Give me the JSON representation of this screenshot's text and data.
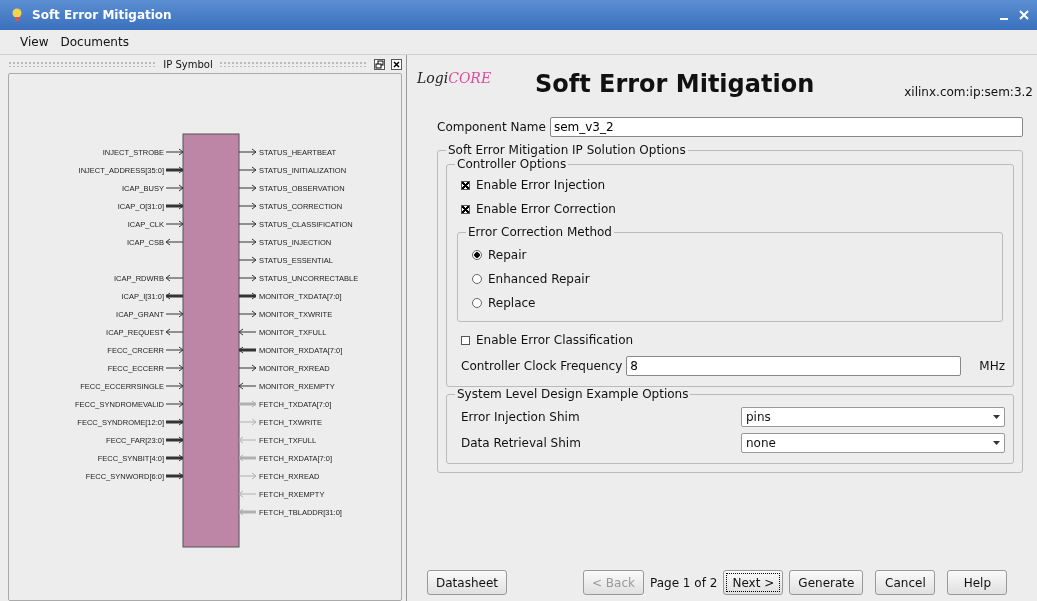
{
  "window": {
    "title": "Soft Error Mitigation"
  },
  "menu": [
    "View",
    "Documents"
  ],
  "symbol_panel": {
    "title": "IP Symbol",
    "rows": [
      {
        "left": {
          "name": "INJECT_STROBE",
          "kind": "input",
          "bus": false
        },
        "right": {
          "name": "STATUS_HEARTBEAT",
          "kind": "output",
          "bus": false,
          "enabled": true
        }
      },
      {
        "left": {
          "name": "INJECT_ADDRESS[35:0]",
          "kind": "input",
          "bus": true
        },
        "right": {
          "name": "STATUS_INITIALIZATION",
          "kind": "output",
          "bus": false,
          "enabled": true
        }
      },
      {
        "left": {
          "name": "ICAP_BUSY",
          "kind": "input",
          "bus": false
        },
        "right": {
          "name": "STATUS_OBSERVATION",
          "kind": "output",
          "bus": false,
          "enabled": true
        }
      },
      {
        "left": {
          "name": "ICAP_O[31:0]",
          "kind": "input",
          "bus": true
        },
        "right": {
          "name": "STATUS_CORRECTION",
          "kind": "output",
          "bus": false,
          "enabled": true
        }
      },
      {
        "left": {
          "name": "ICAP_CLK",
          "kind": "input",
          "bus": false
        },
        "right": {
          "name": "STATUS_CLASSIFICATION",
          "kind": "output",
          "bus": false,
          "enabled": true
        }
      },
      {
        "left": {
          "name": "ICAP_CSB",
          "kind": "output",
          "bus": false
        },
        "right": {
          "name": "STATUS_INJECTION",
          "kind": "output",
          "bus": false,
          "enabled": true
        }
      },
      {
        "right": {
          "name": "STATUS_ESSENTIAL",
          "kind": "output",
          "bus": false,
          "enabled": true
        }
      },
      {
        "left": {
          "name": "ICAP_RDWRB",
          "kind": "output",
          "bus": false
        },
        "right": {
          "name": "STATUS_UNCORRECTABLE",
          "kind": "output",
          "bus": false,
          "enabled": true
        }
      },
      {
        "left": {
          "name": "ICAP_I[31:0]",
          "kind": "output",
          "bus": true
        },
        "right": {
          "name": "MONITOR_TXDATA[7:0]",
          "kind": "output",
          "bus": true,
          "enabled": true
        }
      },
      {
        "left": {
          "name": "ICAP_GRANT",
          "kind": "input",
          "bus": false
        },
        "right": {
          "name": "MONITOR_TXWRITE",
          "kind": "output",
          "bus": false,
          "enabled": true
        }
      },
      {
        "left": {
          "name": "ICAP_REQUEST",
          "kind": "output",
          "bus": false
        },
        "right": {
          "name": "MONITOR_TXFULL",
          "kind": "input",
          "bus": false,
          "enabled": true
        }
      },
      {
        "left": {
          "name": "FECC_CRCERR",
          "kind": "input",
          "bus": false
        },
        "right": {
          "name": "MONITOR_RXDATA[7:0]",
          "kind": "input",
          "bus": true,
          "enabled": true
        }
      },
      {
        "left": {
          "name": "FECC_ECCERR",
          "kind": "input",
          "bus": false
        },
        "right": {
          "name": "MONITOR_RXREAD",
          "kind": "output",
          "bus": false,
          "enabled": true
        }
      },
      {
        "left": {
          "name": "FECC_ECCERRSINGLE",
          "kind": "input",
          "bus": false
        },
        "right": {
          "name": "MONITOR_RXEMPTY",
          "kind": "input",
          "bus": false,
          "enabled": true
        }
      },
      {
        "left": {
          "name": "FECC_SYNDROMEVALID",
          "kind": "input",
          "bus": false
        },
        "right": {
          "name": "FETCH_TXDATA[7:0]",
          "kind": "output",
          "bus": true,
          "enabled": false
        }
      },
      {
        "left": {
          "name": "FECC_SYNDROME[12:0]",
          "kind": "input",
          "bus": true
        },
        "right": {
          "name": "FETCH_TXWRITE",
          "kind": "output",
          "bus": false,
          "enabled": false
        }
      },
      {
        "left": {
          "name": "FECC_FAR[23:0]",
          "kind": "input",
          "bus": true
        },
        "right": {
          "name": "FETCH_TXFULL",
          "kind": "input",
          "bus": false,
          "enabled": false
        }
      },
      {
        "left": {
          "name": "FECC_SYNBIT[4:0]",
          "kind": "input",
          "bus": true
        },
        "right": {
          "name": "FETCH_RXDATA[7:0]",
          "kind": "input",
          "bus": true,
          "enabled": false
        }
      },
      {
        "left": {
          "name": "FECC_SYNWORD[6:0]",
          "kind": "input",
          "bus": true
        },
        "right": {
          "name": "FETCH_RXREAD",
          "kind": "output",
          "bus": false,
          "enabled": false
        }
      },
      {
        "right": {
          "name": "FETCH_RXEMPTY",
          "kind": "input",
          "bus": false,
          "enabled": false
        }
      },
      {
        "right": {
          "name": "FETCH_TBLADDR[31:0]",
          "kind": "input",
          "bus": true,
          "enabled": false
        }
      }
    ]
  },
  "header": {
    "logo_prefix": "Logi",
    "logo_suffix": "CORE",
    "title": "Soft Error Mitigation",
    "vlnv": "xilinx.com:ip:sem:3.2"
  },
  "component_name": {
    "label": "Component Name",
    "value": "sem_v3_2"
  },
  "options": {
    "title": "Soft Error Mitigation IP Solution Options",
    "controller": {
      "title": "Controller Options",
      "checks_top": [
        {
          "label": "Enable Error Injection",
          "checked": true
        },
        {
          "label": "Enable Error Correction",
          "checked": true
        }
      ],
      "method": {
        "title": "Error Correction Method",
        "choices": [
          {
            "label": "Repair",
            "selected": true
          },
          {
            "label": "Enhanced Repair",
            "selected": false
          },
          {
            "label": "Replace",
            "selected": false
          }
        ]
      },
      "checks_bottom": [
        {
          "label": "Enable Error Classification",
          "checked": false
        }
      ],
      "clock": {
        "label": "Controller Clock Frequency",
        "value": "8",
        "unit": "MHz"
      }
    },
    "example": {
      "title": "System Level Design Example Options",
      "dropdowns": [
        {
          "label": "Error Injection Shim",
          "value": "pins"
        },
        {
          "label": "Data Retrieval Shim",
          "value": "none"
        }
      ]
    }
  },
  "footer": [
    [
      {
        "label": "Datasheet",
        "kind": "button",
        "disabled": false,
        "focused": false
      }
    ],
    [
      {
        "label": "< Back",
        "kind": "button",
        "disabled": true,
        "focused": false
      },
      {
        "label": "Page 1 of 2",
        "kind": "text"
      },
      {
        "label": "Next >",
        "kind": "button",
        "disabled": false,
        "focused": true
      }
    ],
    [
      {
        "label": "Generate",
        "kind": "button",
        "disabled": false,
        "focused": false
      },
      {
        "label": "Cancel",
        "kind": "button",
        "disabled": false,
        "focused": false
      },
      {
        "label": "Help",
        "kind": "button",
        "disabled": false,
        "focused": false
      }
    ]
  ]
}
